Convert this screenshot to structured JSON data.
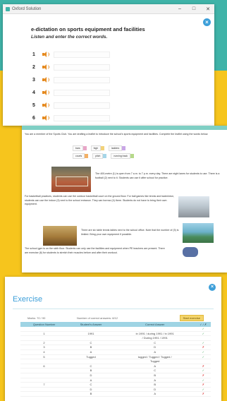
{
  "dictation": {
    "window_title": "Oxford Solution",
    "controls": [
      "–",
      "□",
      "✕"
    ],
    "title": "e-dictation on sports equipment and facilities",
    "instruction": "Listen and enter the correct words.",
    "items": [
      "1",
      "2",
      "3",
      "4",
      "5",
      "6"
    ]
  },
  "leaflet": {
    "intro": "You are a member of the Sports Club. You are drafting a leaflet to introduce the school's sports equipment and facilities. Complete the leaflet using the words below.",
    "word_bank": [
      [
        {
          "word": "bars",
          "color": "#e8a6c8"
        },
        {
          "word": "high",
          "color": "#f2d27a"
        },
        {
          "word": "ladders",
          "color": "#c9a6e6"
        }
      ],
      [
        {
          "word": "courts",
          "color": "#f3b066"
        },
        {
          "word": "pitch",
          "color": "#a6d6e8"
        },
        {
          "word": "running track",
          "color": "#b6d98a"
        }
      ]
    ],
    "p1": "The 400-metre (1)   is open from 7 a.m. to 7 p.m. every day. There are eight lanes for students to use. There is a football (2)   next to it. Students can use it after school for practice.",
    "p2": "For basketball practices, students can use the outdoor basketball court on the ground floor. For ball games like tennis and badminton, students can use the indoor (3)   next to the school entrance. They can borrow (4)   there. Students do not have to bring their own equipment.",
    "p3": "There are six table tennis tables next to the school office. Note that the number of (5)   is limited. Bring your own equipment if possible.",
    "p4": "The school gym is on the sixth floor. Students can only use the facilities and equipment when PE teachers are present. There are exercise (6)   for students to stretch their muscles before and after their workout."
  },
  "exercise": {
    "title": "Exercise",
    "marks": "Marks: 70 / 90",
    "correct": "Number of correct answers: 8/12",
    "button": "Start exercise",
    "headers": [
      "Question Number",
      "Student's Answer",
      "Correct Answer",
      "✓ / ✗"
    ],
    "rows": [
      {
        "q": "",
        "student": "",
        "correct": "",
        "mark": "✓"
      },
      {
        "q": "1",
        "student": "1991",
        "correct": "in 1991 / during 1991 / in 1991",
        "mark": "✓"
      },
      {
        "q": "",
        "student": "",
        "correct": "/ During 1991 / 1991",
        "mark": ""
      },
      {
        "q": "2",
        "student": "C",
        "correct": "C",
        "mark": "✓"
      },
      {
        "q": "3",
        "student": "B",
        "correct": "D",
        "mark": "✗"
      },
      {
        "q": "4",
        "student": "A",
        "correct": "A",
        "mark": "✓"
      },
      {
        "q": "5",
        "student": "Tugged",
        "correct": "tugged / Tugged / Tugged /",
        "mark": "✓"
      },
      {
        "q": "",
        "student": "",
        "correct": "Tugged",
        "mark": ""
      },
      {
        "q": "6",
        "student": "C",
        "correct": "A",
        "mark": "✗"
      },
      {
        "q": "",
        "student": "B",
        "correct": "C",
        "mark": "✓"
      },
      {
        "q": "",
        "student": "D",
        "correct": "B",
        "mark": "✗"
      },
      {
        "q": "",
        "student": "A",
        "correct": "A",
        "mark": "✓"
      },
      {
        "q": "7",
        "student": "C",
        "correct": "B",
        "mark": "✗"
      },
      {
        "q": "",
        "student": "D",
        "correct": "D",
        "mark": "✓"
      },
      {
        "q": "",
        "student": "B",
        "correct": "A",
        "mark": "✗"
      }
    ]
  },
  "colors": {
    "teal": "#3fb3a8",
    "yellow": "#f6c51d",
    "accent_blue": "#3d9fd9",
    "speaker_orange": "#e58a1f"
  }
}
